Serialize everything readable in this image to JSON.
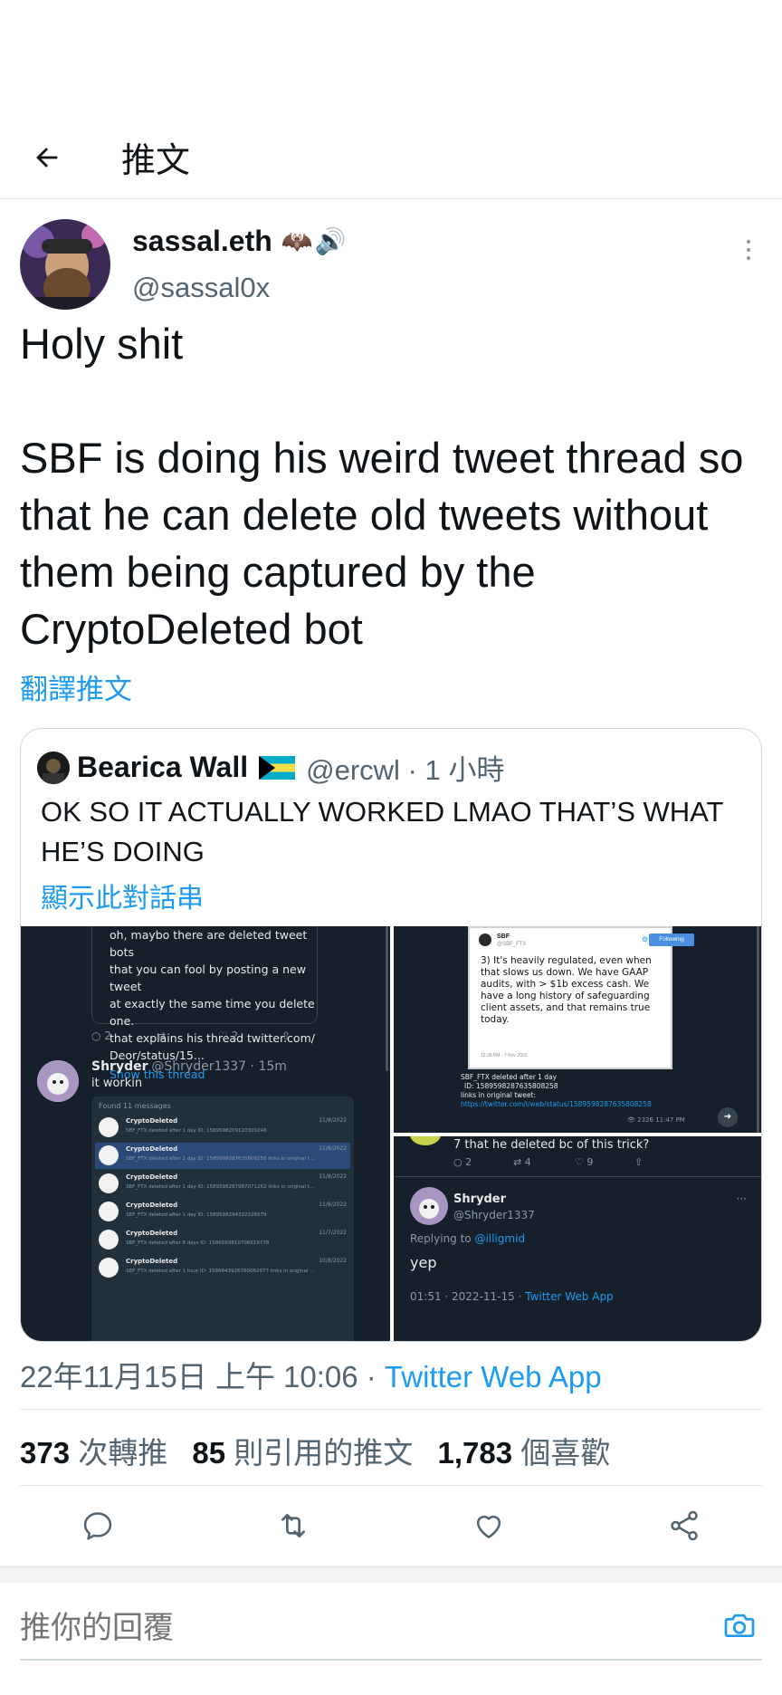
{
  "header": {
    "title": "推文"
  },
  "author": {
    "display_name": "sassal.eth",
    "name_emoji": "🦇🔊",
    "handle": "@sassal0x"
  },
  "tweet": {
    "text": "Holy shit\n\nSBF is doing his weird tweet thread so that he can delete old tweets without them being captured by the CryptoDeleted bot",
    "translate_label": "翻譯推文",
    "timestamp": "22年11月15日 上午 10:06 · ",
    "source": "Twitter Web App"
  },
  "quote": {
    "name": "Bearica Wall",
    "handle": "@ercwl · 1 小時",
    "text": "OK SO IT ACTUALLY WORKED LMAO THAT’S WHAT HE’S DOING",
    "show_thread": "顯示此對話串",
    "media": {
      "left": {
        "text_lines": [
          "oh, maybo there are deleted tweet bots",
          "that you can fool by posting a new tweet",
          "at exactly the same time you delete one.",
          "that explains his thread twitter.com/",
          "Deor/status/15..."
        ],
        "show_thread": "Show this thread",
        "counts": [
          "2",
          "2"
        ],
        "reply_name": "Shryder",
        "reply_handle": "@Shryder1337 · 15m",
        "reply_text": "it workin",
        "found_label": "Found 11 messages",
        "rows": [
          {
            "title": "CryptoDeleted",
            "date": "11/8/2022",
            "desc": "SBF_FTX deleted after 1 day ID: 1589598209120309248"
          },
          {
            "title": "CryptoDeleted",
            "date": "11/8/2022",
            "desc": "SBF_FTX deleted after 1 day ID: 1589598287635808258 links in original t..."
          },
          {
            "title": "CryptoDeleted",
            "date": "11/8/2022",
            "desc": "SBF_FTX deleted after 1 day ID: 1589598287987071262 links in original t..."
          },
          {
            "title": "CryptoDeleted",
            "date": "11/8/2022",
            "desc": "SBF_FTX deleted after 1 day ID: 1589598294322326579"
          },
          {
            "title": "CryptoDeleted",
            "date": "11/7/2022",
            "desc": "SBF_FTX deleted after 8 days ID: 1586569810706619778"
          },
          {
            "title": "CryptoDeleted",
            "date": "10/8/2022",
            "desc": "SBF_FTX deleted after 1 hour ID: 1586643926760062977 links in original ..."
          }
        ]
      },
      "top_right": {
        "tweet_name": "SBF",
        "tweet_handle": "@SBF_FTX",
        "following": "Following",
        "tweet_text": "3) It's heavily regulated, even when that slows us down. We have GAAP audits, with > $1b excess cash. We have a long history of safeguarding client assets, and that remains true today.",
        "tweet_time": "12:38 PM · 7 Nov 2022",
        "caption_lines": [
          "SBF_FTX deleted after 1 day",
          "ID: 1589598287635808258",
          "links in original tweet:"
        ],
        "caption_link": "https://twitter.com/i/web/status/1589598287635808258",
        "views": "2326",
        "time": "11:47 PM"
      },
      "bottom_right": {
        "top_text": "7 that he deleted bc of this trick?",
        "counts": [
          "2",
          "4",
          "9"
        ],
        "name": "Shryder",
        "handle": "@Shryder1337",
        "replying_prefix": "Replying to ",
        "replying_to": "@illigmid",
        "text": "yep",
        "meta": "01:51 · 2022-11-15 · ",
        "source": "Twitter Web App"
      }
    }
  },
  "stats": {
    "retweets": "373",
    "retweets_label": " 次轉推",
    "quotes": "85",
    "quotes_label": " 則引用的推文",
    "likes": "1,783",
    "likes_label": " 個喜歡"
  },
  "reply": {
    "placeholder": "推你的回覆"
  },
  "icons": [
    "back-arrow-icon",
    "more-vertical-icon",
    "reply-icon",
    "retweet-icon",
    "like-icon",
    "share-icon",
    "camera-icon"
  ],
  "colors": {
    "accent": "#1d9bf0",
    "text": "#0f1419",
    "secondary": "#536471",
    "dark_media": "#15202b"
  }
}
